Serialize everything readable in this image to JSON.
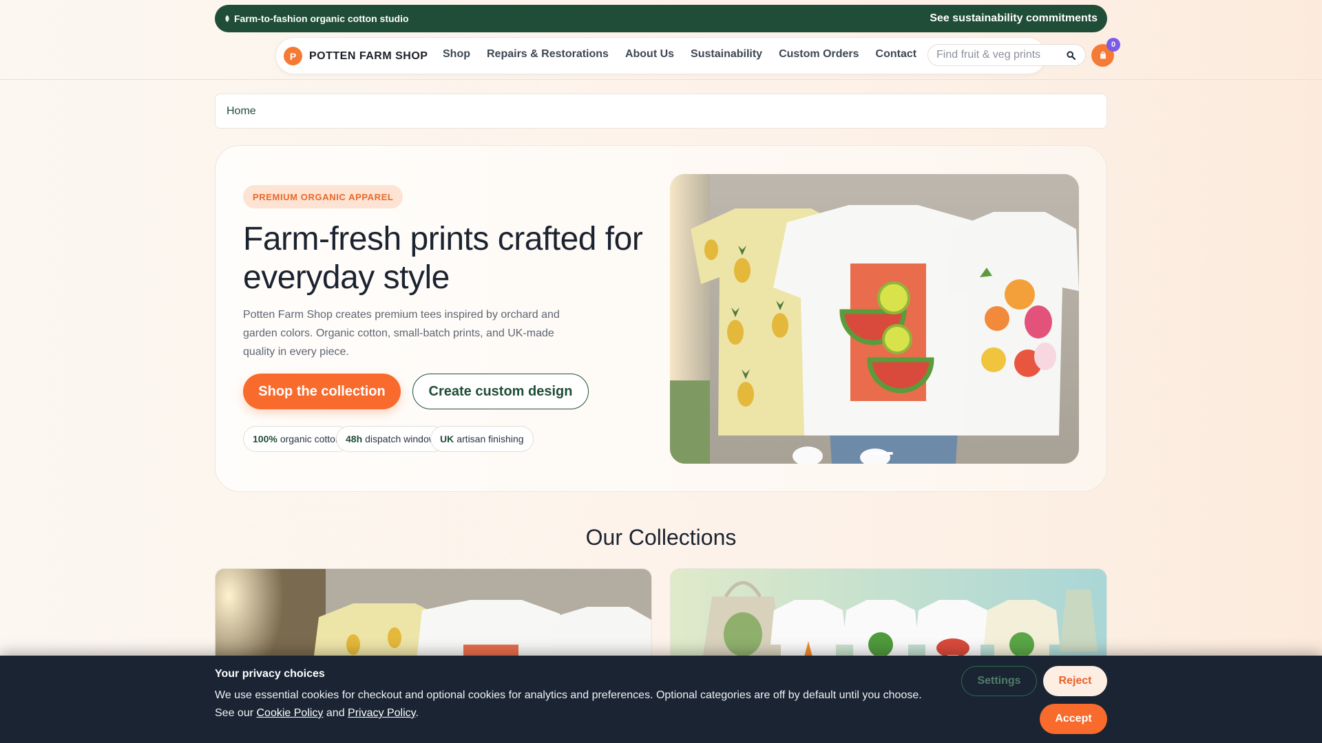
{
  "topbar": {
    "tagline": "Farm-to-fashion organic cotton studio",
    "link": "See sustainability commitments"
  },
  "header": {
    "logo_letter": "P",
    "brand": "POTTEN FARM SHOP",
    "nav": [
      "Shop",
      "Repairs & Restorations",
      "About Us",
      "Sustainability",
      "Custom Orders",
      "Contact"
    ],
    "search_placeholder": "Find fruit & veg prints",
    "cart_count": "0"
  },
  "breadcrumb": {
    "home": "Home"
  },
  "hero": {
    "badge": "PREMIUM ORGANIC APPAREL",
    "title": "Farm-fresh prints crafted for everyday style",
    "description": "Potten Farm Shop creates premium tees inspired by orchard and garden colors. Organic cotton, small-batch prints, and UK-made quality in every piece.",
    "primary_cta": "Shop the collection",
    "secondary_cta": "Create custom design",
    "stats": [
      {
        "value": "100%",
        "label": "organic cotton"
      },
      {
        "value": "48h",
        "label": "dispatch window"
      },
      {
        "value": "UK",
        "label": "artisan finishing"
      }
    ]
  },
  "collections": {
    "title": "Our Collections"
  },
  "cookie": {
    "title": "Your privacy choices",
    "text": "We use essential cookies for checkout and optional cookies for analytics and preferences. Optional categories are off by default until you choose.",
    "see_our": "See our",
    "cookie_policy": "Cookie Policy",
    "and": "and",
    "privacy_policy": "Privacy Policy",
    "period": ".",
    "settings": "Settings",
    "reject": "Reject",
    "accept": "Accept"
  },
  "colors": {
    "brand_green": "#1f4d37",
    "accent_orange": "#f86b2c",
    "badge_purple": "#7c5ce6",
    "cookie_bg": "#1a2433"
  },
  "icons": [
    "leaf-icon",
    "search-icon",
    "cart-icon"
  ]
}
